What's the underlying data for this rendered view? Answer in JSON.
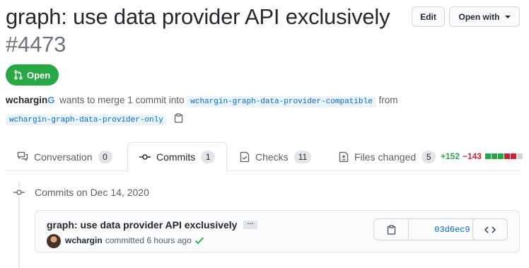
{
  "header": {
    "title": "graph: use data provider API exclusively",
    "number": "#4473",
    "edit_label": "Edit",
    "open_with_label": "Open with"
  },
  "state": {
    "label": "Open",
    "color": "#28a745"
  },
  "meta": {
    "author": "wchargin",
    "author_badge": "G",
    "text_before": "wants to merge 1 commit into",
    "base_branch": "wchargin-graph-data-provider-compatible",
    "text_from": "from",
    "head_branch": "wchargin-graph-data-provider-only"
  },
  "tabs": [
    {
      "label": "Conversation",
      "count": "0",
      "icon": "comment-discussion-icon"
    },
    {
      "label": "Commits",
      "count": "1",
      "icon": "git-commit-icon",
      "active": true
    },
    {
      "label": "Checks",
      "count": "11",
      "icon": "checklist-icon"
    },
    {
      "label": "Files changed",
      "count": "5",
      "icon": "file-diff-icon"
    }
  ],
  "diffstat": {
    "additions": "+152",
    "deletions": "−143",
    "blocks": [
      "#28a745",
      "#28a745",
      "#28a745",
      "#cb2431",
      "#cb2431",
      "#d1d5da"
    ]
  },
  "timeline": {
    "day_label": "Commits on Dec 14, 2020",
    "commit": {
      "title": "graph: use data provider API exclusively",
      "expand_label": "…",
      "author": "wchargin",
      "committed_text": "committed 6 hours ago",
      "status": "success",
      "sha": "03d6ec9"
    }
  },
  "colors": {
    "link": "#0366d6",
    "success": "#28a745",
    "danger": "#cb2431"
  }
}
